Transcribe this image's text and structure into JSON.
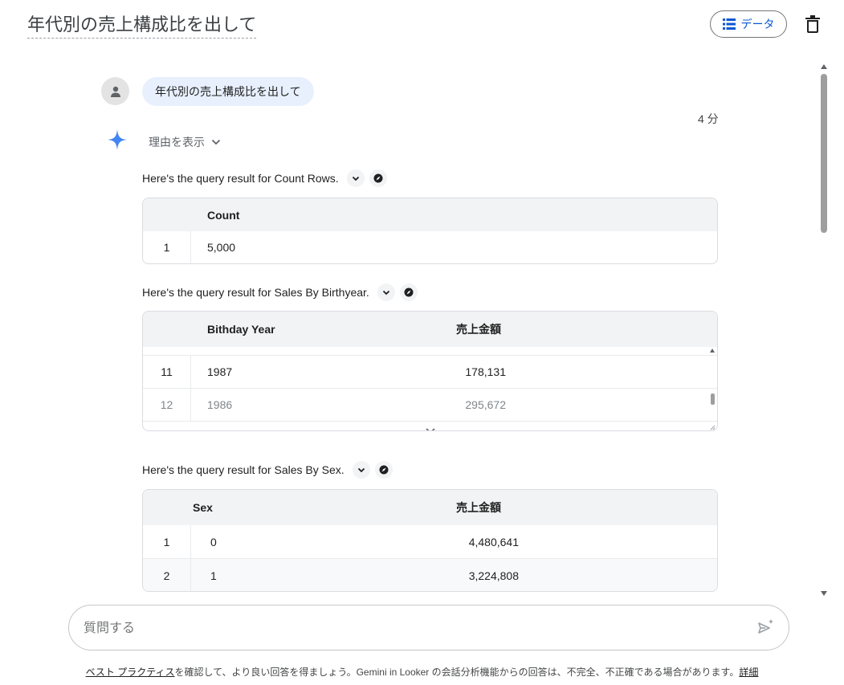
{
  "header": {
    "title": "年代別の売上構成比を出して",
    "data_button_label": "データ"
  },
  "user_message": {
    "text": "年代別の売上構成比を出して",
    "timestamp": "4 分"
  },
  "gemini": {
    "reason_label": "理由を表示"
  },
  "results": [
    {
      "caption": "Here's the query result for Count Rows.",
      "columns": [
        "",
        "Count"
      ],
      "rows": [
        {
          "index": "1",
          "cells": [
            "5,000"
          ]
        }
      ]
    },
    {
      "caption": "Here's the query result for Sales By Birthyear.",
      "columns": [
        "",
        "Bithday Year",
        "売上金額"
      ],
      "rows": [
        {
          "index": "11",
          "cells": [
            "1987",
            "178,131"
          ]
        },
        {
          "index": "12",
          "cells": [
            "1986",
            "295,672"
          ]
        }
      ]
    },
    {
      "caption": "Here's the query result for Sales By Sex.",
      "columns": [
        "",
        "Sex",
        "売上金額"
      ],
      "rows": [
        {
          "index": "1",
          "cells": [
            "0",
            "4,480,641"
          ]
        },
        {
          "index": "2",
          "cells": [
            "1",
            "3,224,808"
          ]
        }
      ]
    }
  ],
  "input": {
    "placeholder": "質問する",
    "value": ""
  },
  "footer": {
    "link_text": "ベスト プラクティス",
    "text": "を確認して、より良い回答を得ましょう。Gemini in Looker の会話分析機能からの回答は、不完全、不正確である場合があります。",
    "details_link": "詳細"
  },
  "colors": {
    "accent": "#0b57d0",
    "bubble": "#e8f0fe",
    "table_header": "#f1f3f4",
    "gemini_star": "#4285f4"
  },
  "icons": {
    "data": "list-icon",
    "delete": "trash-icon",
    "avatar": "person-icon",
    "gemini": "sparkle-icon",
    "expand": "chevron-down-icon",
    "explore": "compass-icon",
    "send": "send-sparkle-icon"
  }
}
